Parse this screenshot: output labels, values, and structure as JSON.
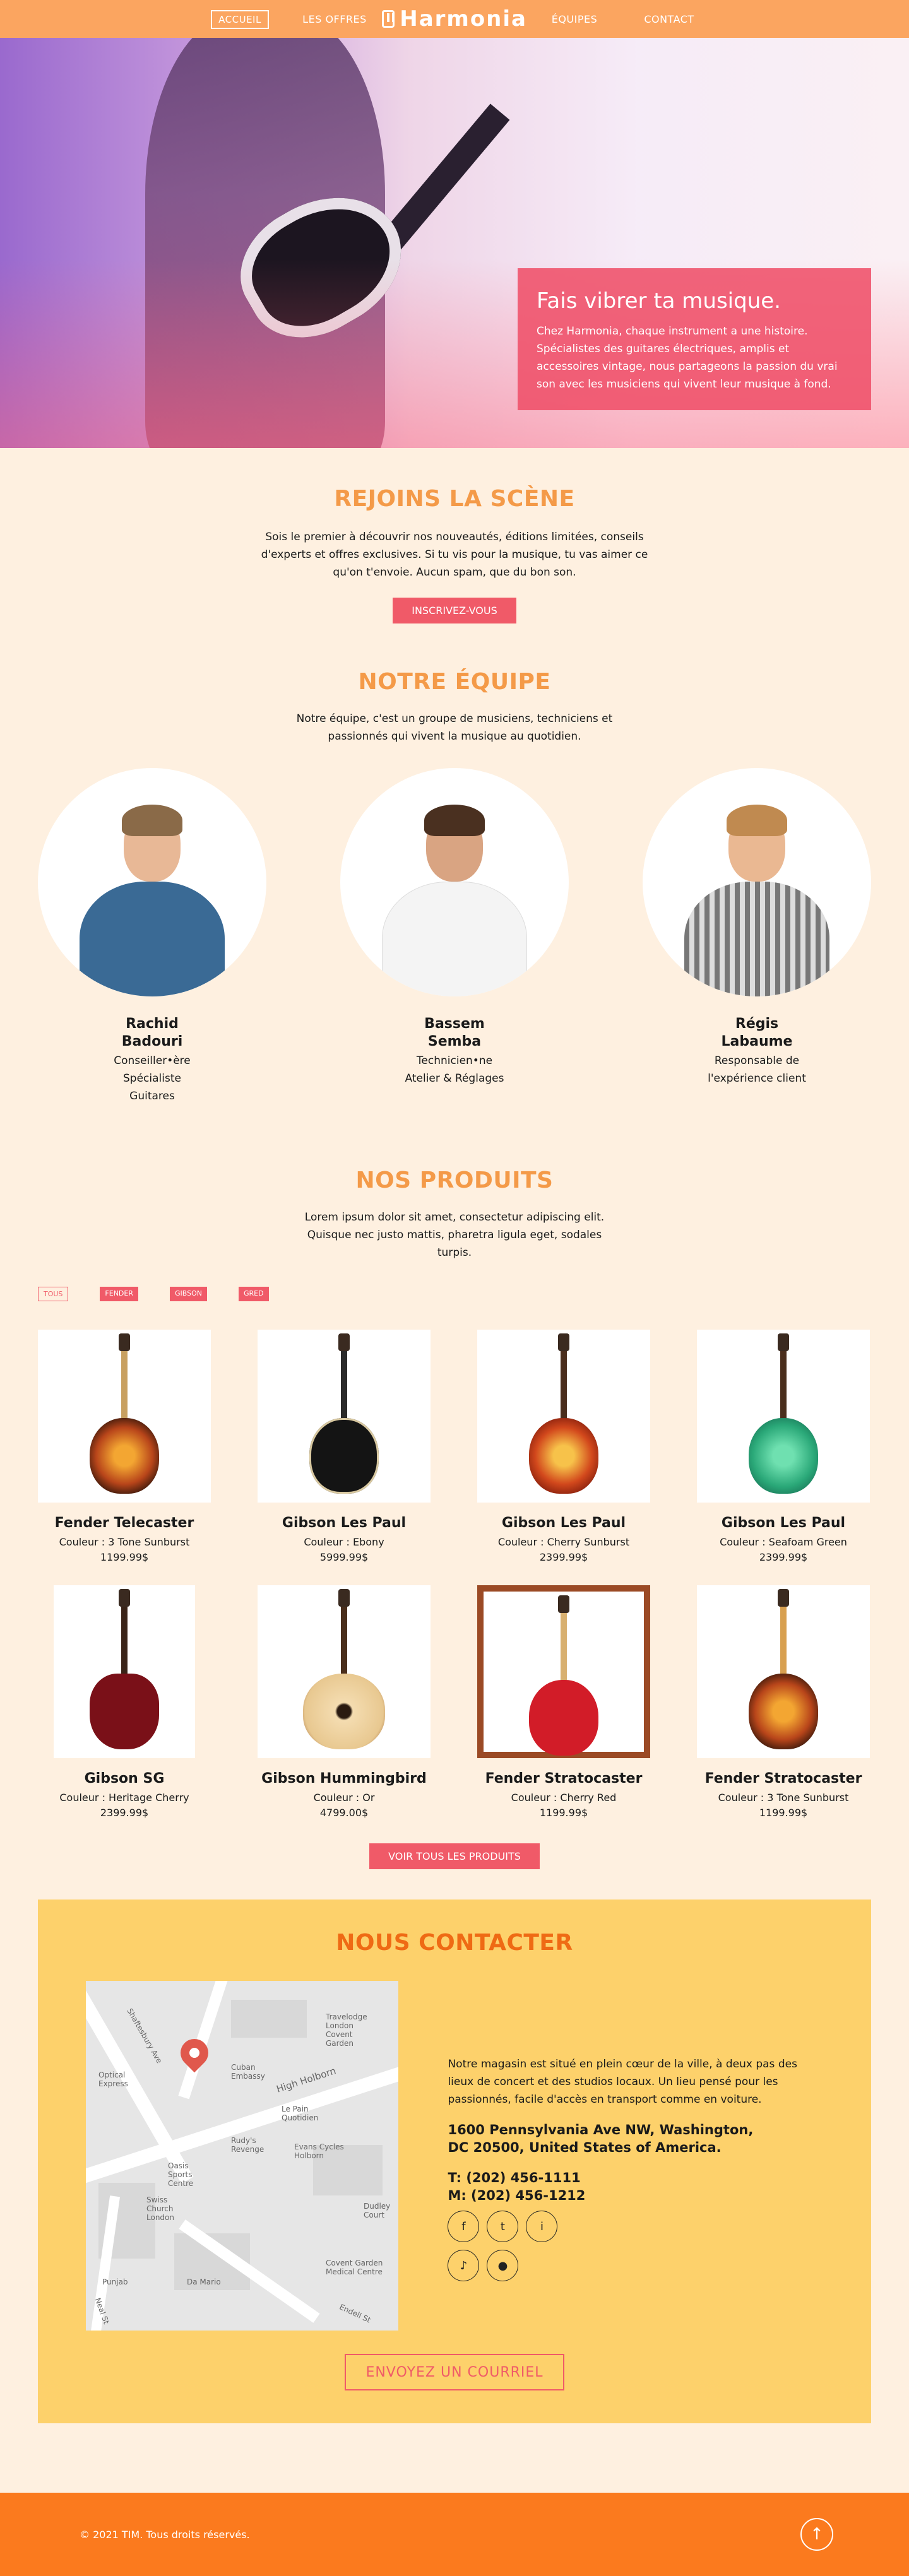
{
  "nav": {
    "items": [
      "ACCUEIL",
      "LES OFFRES",
      "ÉQUIPES",
      "CONTACT"
    ],
    "logo": "Harmonia"
  },
  "hero": {
    "title": "Fais vibrer ta musique.",
    "text": "Chez Harmonia, chaque instrument a une histoire. Spécialistes des guitares électriques, amplis et accessoires vintage, nous partageons la passion du vrai son avec les musiciens qui vivent leur musique à fond."
  },
  "join": {
    "title": "REJOINS LA SCÈNE",
    "text": "Sois le premier à découvrir nos nouveautés, éditions limitées, conseils d'experts et offres exclusives. Si tu vis pour la musique, tu vas aimer ce qu'on t'envoie. Aucun spam, que du bon son.",
    "button": "INSCRIVEZ-VOUS"
  },
  "team": {
    "title": "NOTRE ÉQUIPE",
    "text": "Notre équipe, c'est un groupe de musiciens, techniciens et passionnés qui vivent la musique au quotidien.",
    "members": [
      {
        "first": "Rachid",
        "last": "Badouri",
        "role1": "Conseiller•ère",
        "role2": "Spécialiste",
        "role3": "Guitares"
      },
      {
        "first": "Bassem",
        "last": "Semba",
        "role1": "Technicien•ne",
        "role2": "Atelier & Réglages",
        "role3": ""
      },
      {
        "first": "Régis",
        "last": "Labaume",
        "role1": "Responsable de",
        "role2": "l'expérience client",
        "role3": ""
      }
    ]
  },
  "products": {
    "title": "NOS PRODUITS",
    "text": "Lorem ipsum dolor sit amet, consectetur adipiscing elit. Quisque nec justo mattis, pharetra ligula eget, sodales turpis.",
    "filters": [
      "TOUS",
      "FENDER",
      "GIBSON",
      "GRED"
    ],
    "items": [
      {
        "name": "Fender Telecaster",
        "color": "Couleur : 3 Tone Sunburst",
        "price": "1199.99$"
      },
      {
        "name": "Gibson Les Paul",
        "color": "Couleur : Ebony",
        "price": "5999.99$"
      },
      {
        "name": "Gibson Les Paul",
        "color": "Couleur : Cherry Sunburst",
        "price": "2399.99$"
      },
      {
        "name": "Gibson Les Paul",
        "color": "Couleur : Seafoam Green",
        "price": "2399.99$"
      },
      {
        "name": "Gibson SG",
        "color": "Couleur : Heritage Cherry",
        "price": "2399.99$"
      },
      {
        "name": "Gibson Hummingbird",
        "color": "Couleur : Or",
        "price": "4799.00$"
      },
      {
        "name": "Fender Stratocaster",
        "color": "Couleur : Cherry Red",
        "price": "1199.99$"
      },
      {
        "name": "Fender Stratocaster",
        "color": "Couleur : 3 Tone Sunburst",
        "price": "1199.99$"
      }
    ],
    "button": "VOIR TOUS LES PRODUITS"
  },
  "contact": {
    "title": "NOUS CONTACTER",
    "desc": "Notre magasin est situé en plein cœur de la ville, à deux pas des lieux de concert et des studios locaux. Un lieu pensé pour les passionnés, facile d'accès en transport comme en voiture.",
    "addr1": "1600 Pennsylvania Ave NW, Washington,",
    "addr2": "DC 20500, United States of America.",
    "tel": "T: (202) 456-1111",
    "mobile": "M: (202) 456-1212",
    "email_button": "ENVOYEZ UN COURRIEL",
    "map_labels": [
      "Travelodge London Covent Garden",
      "Cuban Embassy",
      "Optical Express",
      "High Holborn",
      "Le Pain Quotidien",
      "Rudy's Revenge",
      "Evans Cycles Holborn",
      "Oasis Sports Centre",
      "Swiss Church London",
      "Dudley Court",
      "Covent Garden Medical Centre",
      "Punjab",
      "Da Mario",
      "Endell St",
      "Neal St",
      "Shaftesbury Ave"
    ]
  },
  "footer": {
    "copy": "© 2021 TIM. Tous droits réservés.",
    "up": "↑"
  }
}
